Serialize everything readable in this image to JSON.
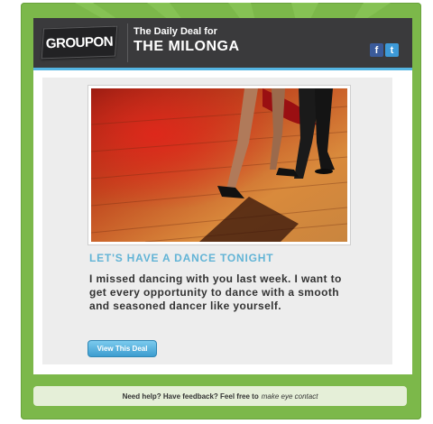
{
  "header": {
    "logo_text": "GROUPON",
    "subtitle": "The Daily Deal for",
    "title": "THE MILONGA",
    "facebook_glyph": "f",
    "twitter_glyph": "t"
  },
  "deal": {
    "image_alt": "dancers-photo",
    "title": "LET'S HAVE A DANCE TONIGHT",
    "description": "I missed dancing with you last week. I want to get every opportunity to dance with a smooth and seasoned dancer like yourself.",
    "button_label": "View This Deal"
  },
  "footer": {
    "text": "Need help? Have feedback? Feel free to",
    "link_text": "make eye contact"
  },
  "colors": {
    "frame_green": "#7cb84a",
    "header_dark": "#3a3a3c",
    "accent_blue": "#54b5e3",
    "title_blue": "#62b4d6"
  }
}
